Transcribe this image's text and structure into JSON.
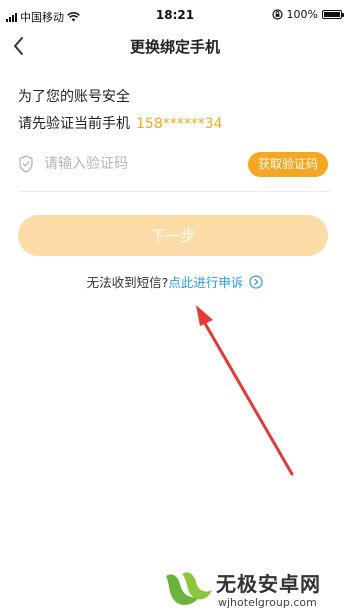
{
  "status_bar": {
    "carrier": "中国移动",
    "time": "18:21",
    "battery_text": "100%",
    "battery_level": 1.0,
    "icons": [
      "signal-icon",
      "wifi-icon",
      "orientation-lock-icon",
      "battery-icon"
    ]
  },
  "nav": {
    "title": "更换绑定手机",
    "back_icon": "chevron-left-icon"
  },
  "intro": {
    "line1": "为了您的账号安全",
    "line2": "请先验证当前手机",
    "phone": "158******34"
  },
  "code_field": {
    "icon": "shield-check-icon",
    "placeholder": "请输入验证码",
    "value": "",
    "get_code_label": "获取验证码"
  },
  "next_button": {
    "label": "下一步",
    "enabled": false
  },
  "help": {
    "question": "无法收到短信?",
    "link": "点此进行申诉",
    "link_icon": "chevron-right-circle-icon"
  },
  "watermark": {
    "title": "无极安卓网",
    "url": "wjhotelgroup.com"
  },
  "colors": {
    "accent": "#f5a623",
    "accent_disabled": "#fcdba6",
    "link": "#2a9ae4",
    "annotation_arrow": "#e53935"
  }
}
